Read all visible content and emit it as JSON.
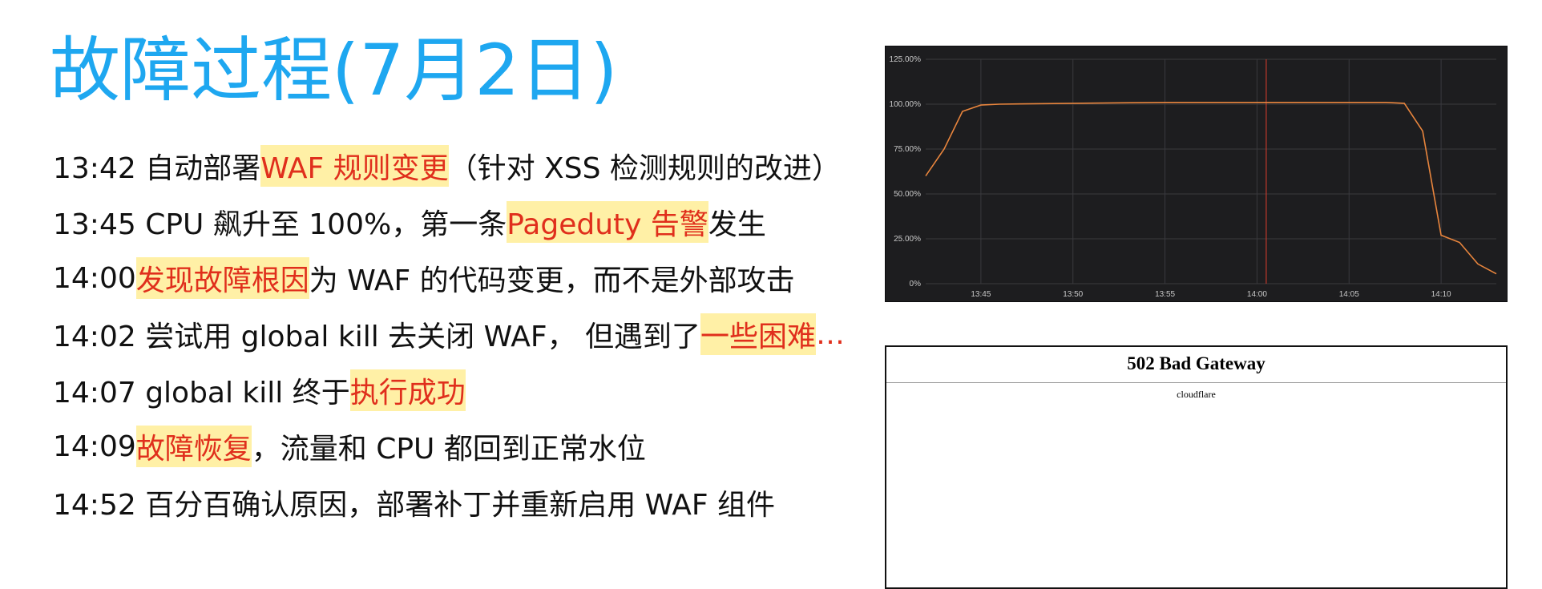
{
  "slide": {
    "title": "故障过程(7月2日)"
  },
  "timeline": [
    {
      "segments": [
        {
          "text": "13:42 自动部署 ",
          "style": "plain"
        },
        {
          "text": "WAF  规则变更",
          "style": "hl"
        },
        {
          "text": "（针对 XSS 检测规则的改进）",
          "style": "plain"
        }
      ]
    },
    {
      "segments": [
        {
          "text": "13:45 CPU 飙升至 100%，第一条 ",
          "style": "plain"
        },
        {
          "text": "Pageduty 告警",
          "style": "hl"
        },
        {
          "text": "发生",
          "style": "plain"
        }
      ]
    },
    {
      "segments": [
        {
          "text": "14:00 ",
          "style": "plain"
        },
        {
          "text": "发现故障根因",
          "style": "hl"
        },
        {
          "text": "为 WAF 的代码变更，而不是外部攻击",
          "style": "plain"
        }
      ]
    },
    {
      "segments": [
        {
          "text": "14:02 尝试用 global kill 去关闭 WAF， 但遇到了",
          "style": "plain"
        },
        {
          "text": "一些困难",
          "style": "hl"
        },
        {
          "text": "…",
          "style": "red"
        }
      ]
    },
    {
      "segments": [
        {
          "text": "14:07 global kill 终于",
          "style": "plain"
        },
        {
          "text": "执行成功",
          "style": "hl"
        }
      ]
    },
    {
      "segments": [
        {
          "text": "14:09 ",
          "style": "plain"
        },
        {
          "text": "故障恢复",
          "style": "hl"
        },
        {
          "text": "，流量和 CPU 都回到正常水位",
          "style": "plain"
        }
      ]
    },
    {
      "segments": [
        {
          "text": "14:52 百分百确认原因，部署补丁并重新启用 WAF 组件",
          "style": "plain"
        }
      ]
    }
  ],
  "chart_data": {
    "type": "line",
    "xlim": [
      "13:42",
      "14:13"
    ],
    "ylim": [
      0,
      125
    ],
    "y_unit": "%",
    "yticks": [
      "0%",
      "25.00%",
      "50.00%",
      "75.00%",
      "100.00%",
      "125.00%"
    ],
    "xticks": [
      "13:45",
      "13:50",
      "13:55",
      "14:00",
      "14:05",
      "14:10"
    ],
    "marker_x": "14:00.5",
    "grid": true,
    "colors": {
      "background": "#1d1d1f",
      "grid": "#3a3a3e",
      "line": "#e8853d",
      "marker": "#c0392b",
      "tick_text": "#c8c8c8"
    },
    "series": [
      {
        "x": [
          "13:42",
          "13:43",
          "13:44",
          "13:45",
          "13:46",
          "13:50",
          "13:55",
          "14:00",
          "14:05",
          "14:07",
          "14:08",
          "14:09",
          "14:10",
          "14:11",
          "14:12",
          "14:13"
        ],
        "y": [
          60,
          75,
          96,
          99.5,
          100,
          100.5,
          101,
          101,
          101,
          101,
          100.5,
          85,
          27,
          23,
          11,
          5.5
        ]
      }
    ]
  },
  "error_page": {
    "title": "502 Bad Gateway",
    "subtitle": "cloudflare"
  }
}
